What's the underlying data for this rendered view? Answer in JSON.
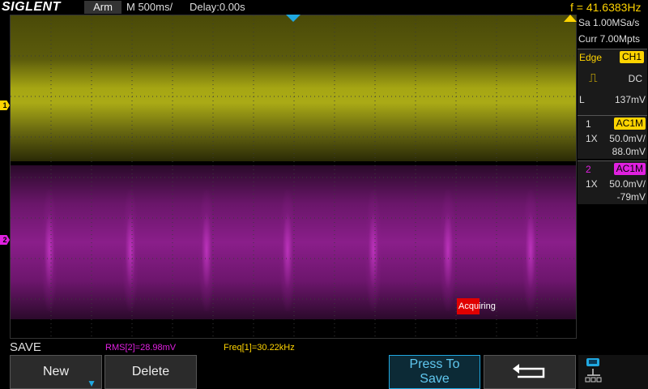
{
  "top_bar": {
    "brand": "SIGLENT",
    "run_state": "Arm",
    "timebase": "M 500ms/",
    "delay": "Delay:0.00s",
    "frequency": "f = 41.6383Hz"
  },
  "acquisition": {
    "sample_rate": "Sa 1.00MSa/s",
    "memory": "Curr 7.00Mpts"
  },
  "trigger": {
    "type_label": "Edge",
    "source": "CH1",
    "slope_icon": "rising-edge-icon",
    "coupling": "DC",
    "level_label": "L",
    "level_value": "137mV"
  },
  "channels": [
    {
      "number": "1",
      "coupling": "AC1M",
      "probe": "1X",
      "scale": "50.0mV/",
      "offset": "88.0mV",
      "color": "#ffd400"
    },
    {
      "number": "2",
      "coupling": "AC1M",
      "probe": "1X",
      "scale": "50.0mV/",
      "offset": "-79mV",
      "color": "#e020e0"
    }
  ],
  "markers": {
    "ch1": "1",
    "ch2": "2"
  },
  "status": {
    "acquiring": "Acquiring"
  },
  "measurements": {
    "rms": "RMS[2]=28.98mV",
    "freq": "Freq[1]=30.22kHz"
  },
  "menu": {
    "title": "SAVE",
    "softkeys": {
      "new": "New",
      "delete": "Delete",
      "press_to_save_line1": "Press To",
      "press_to_save_line2": "Save",
      "back_icon": "return-arrow-icon"
    }
  },
  "colors": {
    "ch1": "#ffd400",
    "ch2": "#e020e0",
    "accent": "#20a8e0",
    "acquiring_bg": "#e00000"
  }
}
